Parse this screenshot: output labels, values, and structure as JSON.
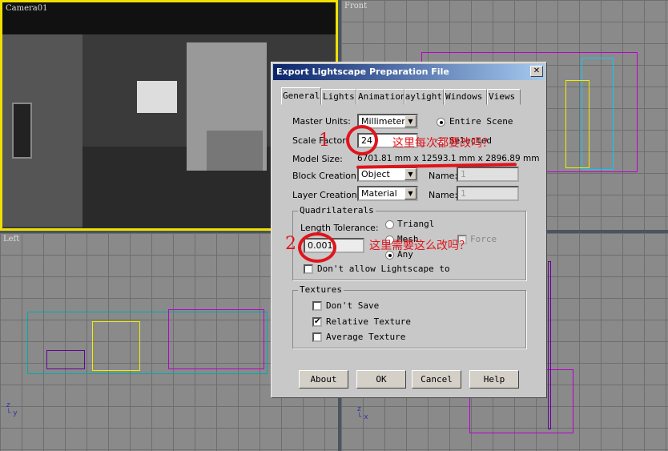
{
  "viewports": {
    "camera": "Camera01",
    "front": "Front",
    "left": "Left"
  },
  "dialog": {
    "title": "Export Lightscape Preparation File",
    "close": "✕",
    "tabs": [
      "General",
      "Lights",
      "Animation",
      "Daylight",
      "Windows",
      "Views"
    ],
    "master_units_label": "Master Units:",
    "master_units_value": "Millimeters",
    "entire_scene": "Entire Scene",
    "selected": "Selected",
    "scale_factor_label": "Scale Factor:",
    "scale_factor_value": "24",
    "model_size_label": "Model Size:",
    "model_size_value": "6701.81 mm x 12593.1 mm x 2896.89 mm",
    "block_creation_label": "Block Creation:",
    "block_creation_value": "Object",
    "layer_creation_label": "Layer Creation:",
    "layer_creation_value": "Material",
    "name_label": "Name:",
    "name_value_1": "1",
    "name_value_2": "1",
    "quad_group": "Quadrilaterals",
    "length_tolerance_label": "Length Tolerance:",
    "length_tolerance_value": "0.001",
    "triangle": "Triangl",
    "mesh": "Mesh",
    "any": "Any",
    "force": "Force",
    "dont_allow": "Don't allow Lightscape to",
    "textures_group": "Textures",
    "dont_save": "Don't Save",
    "relative_texture": "Relative Texture",
    "average_texture": "Average Texture",
    "buttons": {
      "about": "About",
      "ok": "OK",
      "cancel": "Cancel",
      "help": "Help"
    }
  },
  "annotations": {
    "num1": "1",
    "text1": "这里每次都要改吗？",
    "num2": "2",
    "text2": "这里需要这么改吗？"
  }
}
